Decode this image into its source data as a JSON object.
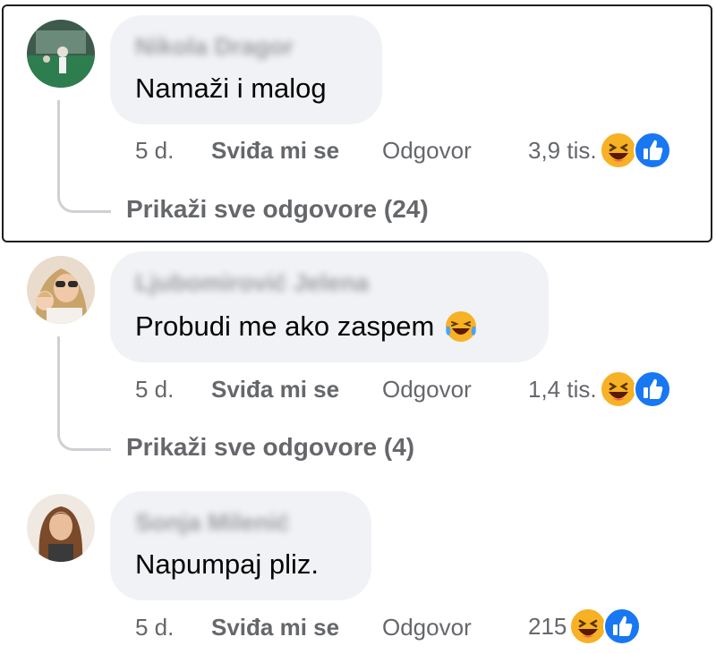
{
  "comments": [
    {
      "author": "Nikola Dragor",
      "text": "Namaži i malog",
      "time": "5 d.",
      "like_label": "Sviđa mi se",
      "reply_label": "Odgovor",
      "reaction_count": "3,9 tis.",
      "view_replies": "Prikaži sve odgovore (24)",
      "highlighted": true
    },
    {
      "author": "Ljubomirović Jelena",
      "text": "Probudi me ako zaspem",
      "text_emoji": "laughing-tears",
      "time": "5 d.",
      "like_label": "Sviđa mi se",
      "reply_label": "Odgovor",
      "reaction_count": "1,4 tis.",
      "view_replies": "Prikaži sve odgovore (4)"
    },
    {
      "author": "Sonja Milenić",
      "text": "Napumpaj pliz.",
      "time": "5 d.",
      "like_label": "Sviđa mi se",
      "reply_label": "Odgovor",
      "reaction_count": "215"
    }
  ],
  "colors": {
    "bubble": "#f0f2f5",
    "meta_text": "#65676b",
    "like_blue": "#1877f2",
    "haha_yellow": "#f7b125",
    "thread_line": "#ced0d4"
  },
  "icons": {
    "haha": "haha-reaction-icon",
    "like": "like-reaction-icon"
  }
}
